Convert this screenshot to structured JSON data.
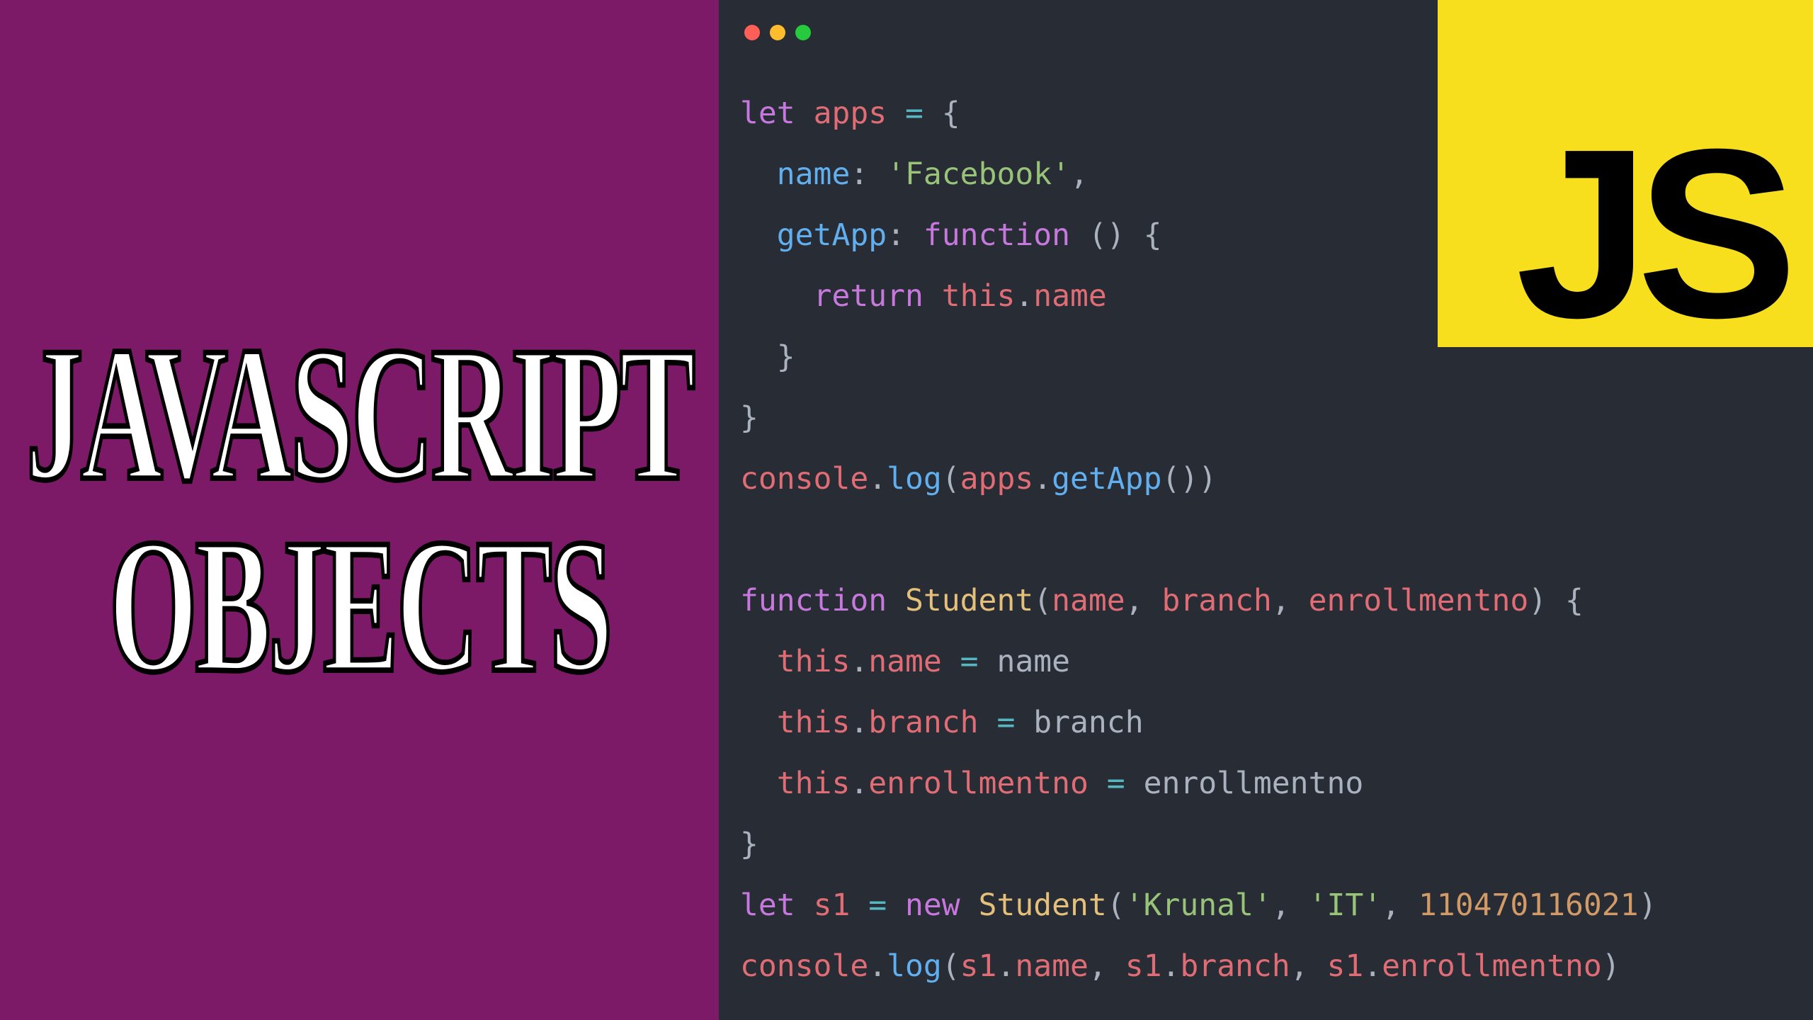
{
  "left": {
    "word1": "JAVASCRIPT",
    "word2": "OBJECTS"
  },
  "badge": {
    "label": "JS"
  },
  "colors": {
    "left_bg": "#7d1a68",
    "editor_bg": "#282c34",
    "badge_bg": "#f7df1e",
    "dot_red": "#ff5f56",
    "dot_yellow": "#ffbd2e",
    "dot_green": "#27c93f"
  },
  "code": {
    "t_let1": "let",
    "t_apps": "apps",
    "t_eq": " = ",
    "t_ob": "{",
    "t_name_key": "name",
    "t_colon": ": ",
    "t_fb": "'Facebook'",
    "t_comma": ",",
    "t_getapp_key": "getApp",
    "t_function_kw": "function",
    "t_parens_empty": " () ",
    "t_ob2": "{",
    "t_return": "return",
    "t_this": "this",
    "t_dot": ".",
    "t_name_prop": "name",
    "t_cb": "}",
    "t_cb2": "}",
    "t_console": "console",
    "t_log": "log",
    "t_op_paren": "(",
    "t_apps2": "apps",
    "t_getapp_call": "getApp",
    "t_call_parens": "()",
    "t_cp": ")",
    "t_function_kw2": "function",
    "t_student": "Student",
    "t_param_name": "name",
    "t_param_sep": ", ",
    "t_param_branch": "branch",
    "t_param_enroll": "enrollmentno",
    "t_cp2": ")",
    "t_ob3": " {",
    "t_this2": "this",
    "t_name_prop2": "name",
    "t_assign": " = ",
    "t_name_var": "name",
    "t_branch_prop": "branch",
    "t_branch_var": "branch",
    "t_enroll_prop": "enrollmentno",
    "t_enroll_var": "enrollmentno",
    "t_cb3": "}",
    "t_let2": "let",
    "t_s1": "s1",
    "t_new": "new",
    "t_student2": "Student",
    "t_krunal": "'Krunal'",
    "t_it": "'IT'",
    "t_enrollnum": "110470116021",
    "t_cp3": ")",
    "t_console2": "console",
    "t_log2": "log",
    "t_s1_2": "s1",
    "t_s1_3": "s1",
    "t_s1_4": "s1",
    "t_name_prop3": "name",
    "t_branch_prop2": "branch",
    "t_enroll_prop2": "enrollmentno",
    "t_cp4": ")",
    "sp_ind1": "  ",
    "sp_ind2": "    ",
    "sp": " "
  }
}
